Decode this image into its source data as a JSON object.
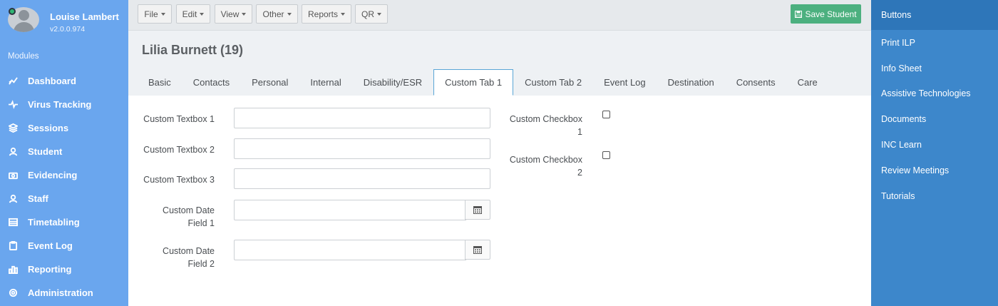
{
  "sidebar": {
    "user_name": "Louise Lambert",
    "version": "v2.0.0.974",
    "modules_label": "Modules",
    "items": [
      {
        "label": "Dashboard",
        "icon": "chart-line-icon"
      },
      {
        "label": "Virus Tracking",
        "icon": "heartbeat-icon"
      },
      {
        "label": "Sessions",
        "icon": "layers-icon"
      },
      {
        "label": "Student",
        "icon": "user-icon"
      },
      {
        "label": "Evidencing",
        "icon": "camera-icon"
      },
      {
        "label": "Staff",
        "icon": "user-icon"
      },
      {
        "label": "Timetabling",
        "icon": "table-icon"
      },
      {
        "label": "Event Log",
        "icon": "clipboard-icon"
      },
      {
        "label": "Reporting",
        "icon": "bar-chart-icon"
      },
      {
        "label": "Administration",
        "icon": "gear-icon"
      }
    ]
  },
  "toolbar": {
    "menus": [
      "File",
      "Edit",
      "View",
      "Other",
      "Reports",
      "QR"
    ],
    "save_label": "Save Student"
  },
  "header": {
    "title": "Lilia Burnett (19)"
  },
  "tabs": [
    {
      "label": "Basic",
      "active": false
    },
    {
      "label": "Contacts",
      "active": false
    },
    {
      "label": "Personal",
      "active": false
    },
    {
      "label": "Internal",
      "active": false
    },
    {
      "label": "Disability/ESR",
      "active": false
    },
    {
      "label": "Custom Tab 1",
      "active": true
    },
    {
      "label": "Custom Tab 2",
      "active": false
    },
    {
      "label": "Event Log",
      "active": false
    },
    {
      "label": "Destination",
      "active": false
    },
    {
      "label": "Consents",
      "active": false
    },
    {
      "label": "Care",
      "active": false
    }
  ],
  "form": {
    "textbox1": {
      "label": "Custom Textbox 1",
      "value": ""
    },
    "textbox2": {
      "label": "Custom Textbox 2",
      "value": ""
    },
    "textbox3": {
      "label": "Custom Textbox 3",
      "value": ""
    },
    "date1": {
      "label_line1": "Custom Date",
      "label_line2": "Field 1",
      "value": ""
    },
    "date2": {
      "label_line1": "Custom Date",
      "label_line2": "Field 2",
      "value": ""
    },
    "checkbox1": {
      "label_line1": "Custom Checkbox",
      "label_line2": "1",
      "checked": false
    },
    "checkbox2": {
      "label_line1": "Custom Checkbox",
      "label_line2": "2",
      "checked": false
    }
  },
  "rightbar": {
    "header": "Buttons",
    "items": [
      "Print ILP",
      "Info Sheet",
      "Assistive Technologies",
      "Documents",
      "INC Learn",
      "Review Meetings",
      "Tutorials"
    ]
  },
  "colors": {
    "sidebar": "#6aa6ee",
    "rightbar": "#3d87cb",
    "save_button": "#4cb07f",
    "active_tab_border": "#5aa6d6"
  }
}
